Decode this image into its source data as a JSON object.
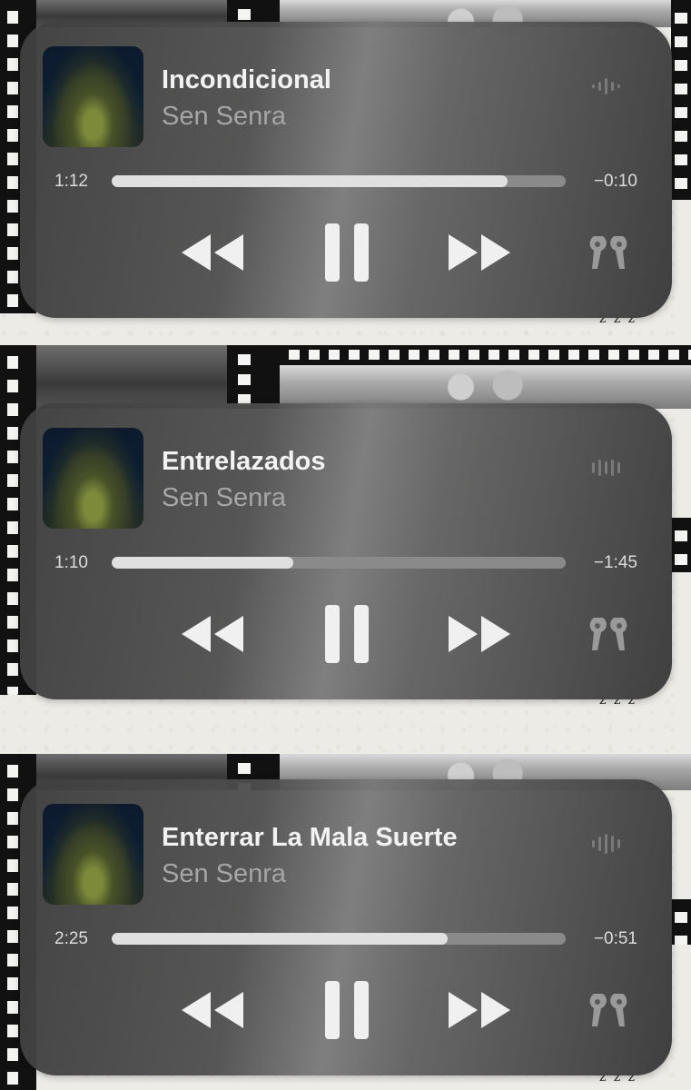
{
  "players": [
    {
      "title": "Incondicional",
      "artist": "Sen Senra",
      "elapsed": "1:12",
      "remaining": "−0:10",
      "progress": 0.872,
      "wave_icon": "waveform-icon"
    },
    {
      "title": "Entrelazados",
      "artist": "Sen Senra",
      "elapsed": "1:10",
      "remaining": "−1:45",
      "progress": 0.4,
      "wave_icon": "waveform-icon"
    },
    {
      "title": "Enterrar La Mala Suerte",
      "artist": "Sen Senra",
      "elapsed": "2:25",
      "remaining": "−0:51",
      "progress": 0.74,
      "wave_icon": "waveform-icon"
    }
  ],
  "icons": {
    "rewind": "rewind-icon",
    "pause": "pause-icon",
    "fast_forward": "fast-forward-icon",
    "airpods": "airpods-icon"
  },
  "colors": {
    "card": "#4a4a4a",
    "progress_fill": "#e0e0e0",
    "progress_track": "#8a8a8a",
    "title": "#f2f2f2",
    "artist": "#a6a6a6"
  }
}
